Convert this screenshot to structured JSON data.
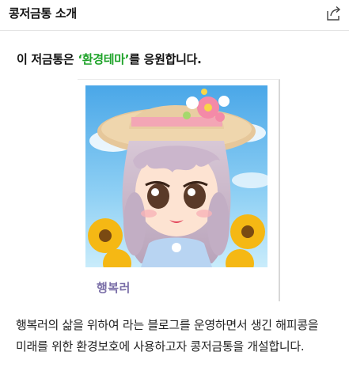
{
  "header": {
    "title": "콩저금통 소개",
    "share_icon": "share-icon"
  },
  "intro": {
    "prefix": "이 저금통은 ",
    "theme": "‘환경테마’",
    "suffix": "를 응원합니다.",
    "theme_color": "#1fa32a"
  },
  "profile": {
    "name": "행복러",
    "name_color": "#7b6fa8"
  },
  "description": "행복러의 삶을 위하여 라는 블로그를 운영하면서 생긴 해피콩을 미래를 위한 환경보호에 사용하고자 콩저금통을 개설합니다."
}
